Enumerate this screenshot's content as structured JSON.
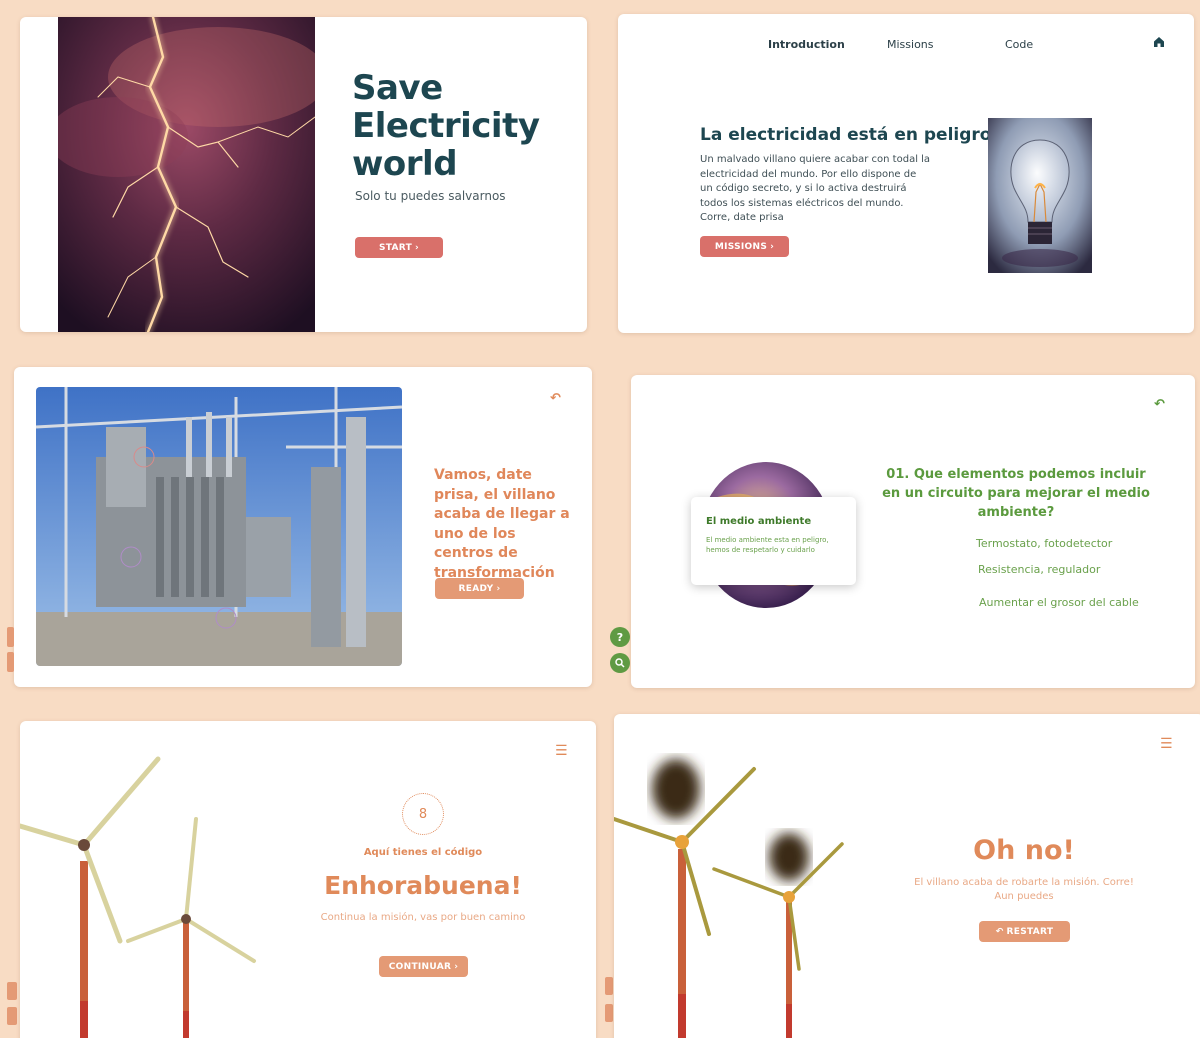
{
  "colors": {
    "background": "#f8dcc4",
    "title_dark": "#1d4650",
    "accent_red": "#d9706a",
    "accent_orange": "#e49a75",
    "text_orange": "#e08a5a",
    "green": "#5b9a3e"
  },
  "slide1": {
    "title_line1": "Save",
    "title_line2": "Electricity",
    "title_line3": "world",
    "subtitle": "Solo tu puedes salvarnos",
    "button_label": "START",
    "image": "lightning-photo"
  },
  "slide2": {
    "nav": {
      "introduction": "Introduction",
      "missions": "Missions",
      "code": "Code",
      "home_icon": "home-icon"
    },
    "heading": "La electricidad está en peligro!",
    "paragraph": "Un malvado villano quiere acabar con todal la electricidad del mundo. Por ello dispone de un código secreto, y si lo activa destruirá todos los sistemas eléctricos del mundo. Corre, date prisa",
    "button_label": "MISSIONS",
    "image": "light-bulb-photo"
  },
  "slide3": {
    "message": "Vamos, date prisa, el villano acaba de llegar a uno de los centros de transformación",
    "button_label": "READY",
    "image": "transformer-substation-photo",
    "back_icon": "undo-icon"
  },
  "slide4": {
    "question": "01. Que elementos podemos incluir en un circuito para mejorar el medio ambiente?",
    "options": [
      "Termostato, fotodetector",
      "Resistencia, regulador",
      "Aumentar el grosor del cable"
    ],
    "popup_title": "El medio ambiente",
    "popup_text": "El medio ambiente esta en peligro, hemos de respetarlo y cuidarlo",
    "image": "globe-photo",
    "back_icon": "undo-icon"
  },
  "helpers": {
    "help_label": "?",
    "search_icon": "search-icon"
  },
  "slide5": {
    "code_digit": "8",
    "code_label": "Aquí tienes el código",
    "title": "Enhorabuena!",
    "subtitle": "Continua la misión, vas por buen camino",
    "button_label": "CONTINUAR",
    "menu_icon": "menu-icon",
    "image": "wind-turbines-photo"
  },
  "slide6": {
    "title": "Oh no!",
    "message": "El villano acaba de robarte la misión. Corre! Aun puedes",
    "button_label": "RESTART",
    "menu_icon": "menu-icon",
    "image": "burning-wind-turbines-photo"
  }
}
